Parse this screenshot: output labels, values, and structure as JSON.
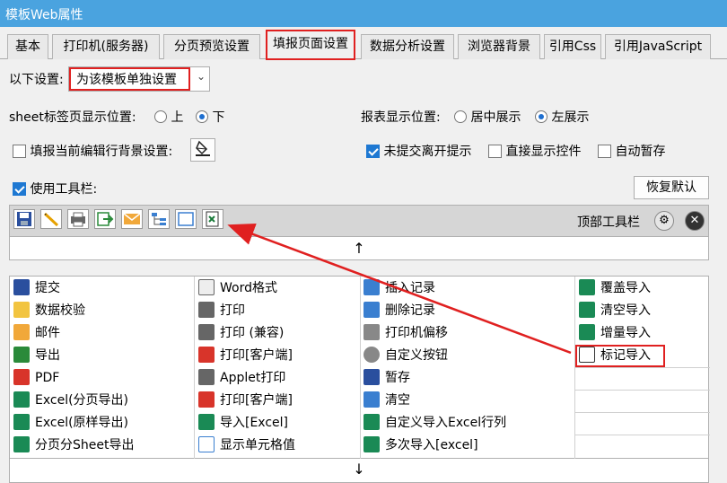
{
  "window": {
    "title": "模板Web属性"
  },
  "tabs": [
    "基本",
    "打印机(服务器)",
    "分页预览设置",
    "填报页面设置",
    "数据分析设置",
    "浏览器背景",
    "引用Css",
    "引用JavaScript"
  ],
  "settings": {
    "scope_label": "以下设置:",
    "scope_value": "为该模板单独设置",
    "sheet_pos_label": "sheet标签页显示位置:",
    "sheet_pos_options": [
      "上",
      "下"
    ],
    "report_pos_label": "报表显示位置:",
    "report_pos_options": [
      "居中展示",
      "左展示"
    ],
    "row_bg_label": "填报当前编辑行背景设置:",
    "unsubmitted_label": "未提交离开提示",
    "direct_control_label": "直接显示控件",
    "autosave_label": "自动暂存",
    "use_toolbar_label": "使用工具栏:",
    "restore_default_label": "恢复默认"
  },
  "toolbar": {
    "label": "顶部工具栏",
    "icons": [
      "save-icon",
      "pencil-icon",
      "printer-icon",
      "export-icon",
      "mail-icon",
      "tree-icon",
      "blank-icon",
      "excel-mark-icon"
    ],
    "up_arrow": "↑",
    "down_arrow": "↓"
  },
  "items": {
    "col1": [
      "提交",
      "数据校验",
      "邮件",
      "导出",
      "PDF",
      "Excel(分页导出)",
      "Excel(原样导出)",
      "分页分Sheet导出"
    ],
    "col2": [
      "Word格式",
      "打印",
      "打印 (兼容)",
      "打印[客户端]",
      "Applet打印",
      "打印[客户端]",
      "导入[Excel]",
      "显示单元格值"
    ],
    "col3": [
      "插入记录",
      "删除记录",
      "打印机偏移",
      "自定义按钮",
      "暂存",
      "清空",
      "自定义导入Excel行列",
      "多次导入[excel]"
    ],
    "col4": [
      "覆盖导入",
      "清空导入",
      "增量导入",
      "标记导入"
    ]
  },
  "colors": {
    "highlight": "#e02020",
    "accent": "#1e78d2",
    "titlebar": "#4aa3df"
  }
}
